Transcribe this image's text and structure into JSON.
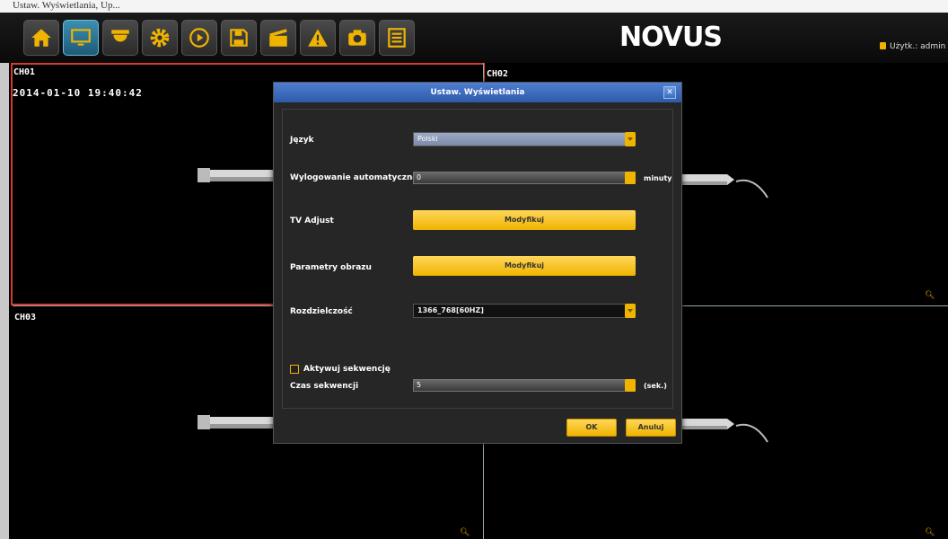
{
  "caption": "Ustaw. Wyświetlania, Up...",
  "toolbar": {
    "buttons": [
      {
        "icon": "home-icon",
        "active": false
      },
      {
        "icon": "monitor-icon",
        "active": true
      },
      {
        "icon": "camera-dome-icon",
        "active": false
      },
      {
        "icon": "gear-icon",
        "active": false
      },
      {
        "icon": "play-icon",
        "active": false
      },
      {
        "icon": "save-icon",
        "active": false
      },
      {
        "icon": "clapperboard-icon",
        "active": false
      },
      {
        "icon": "warning-icon",
        "active": false
      },
      {
        "icon": "photo-camera-icon",
        "active": false
      },
      {
        "icon": "list-icon",
        "active": false
      }
    ]
  },
  "brand": "NOVUS",
  "user": "Użytk.: admin",
  "channels": {
    "ch1": "CH01",
    "ch2": "CH02",
    "ch3": "CH03",
    "timestamp": "2014-01-10 19:40:42"
  },
  "dialog": {
    "title": "Ustaw. Wyświetlania",
    "language_label": "Język",
    "language_value": "Polski",
    "autologout_label": "Wylogowanie automatyczne",
    "autologout_value": "0",
    "autologout_unit": "minuty",
    "tv_adjust_label": "TV Adjust",
    "tv_adjust_button": "Modyfikuj",
    "image_params_label": "Parametry obrazu",
    "image_params_button": "Modyfikuj",
    "resolution_label": "Rozdzielczość",
    "resolution_value": "1366_768[60HZ]",
    "sequence_checkbox_label": "Aktywuj sekwencję",
    "sequence_checked": false,
    "sequence_time_label": "Czas sekwencji",
    "sequence_time_value": "5",
    "sequence_time_unit": "(sek.)",
    "ok_button": "OK",
    "cancel_button": "Anuluj"
  },
  "colors": {
    "accent": "#f0b400",
    "title_bar": "#3a68b8",
    "selected_channel_border": "#d23a32"
  }
}
